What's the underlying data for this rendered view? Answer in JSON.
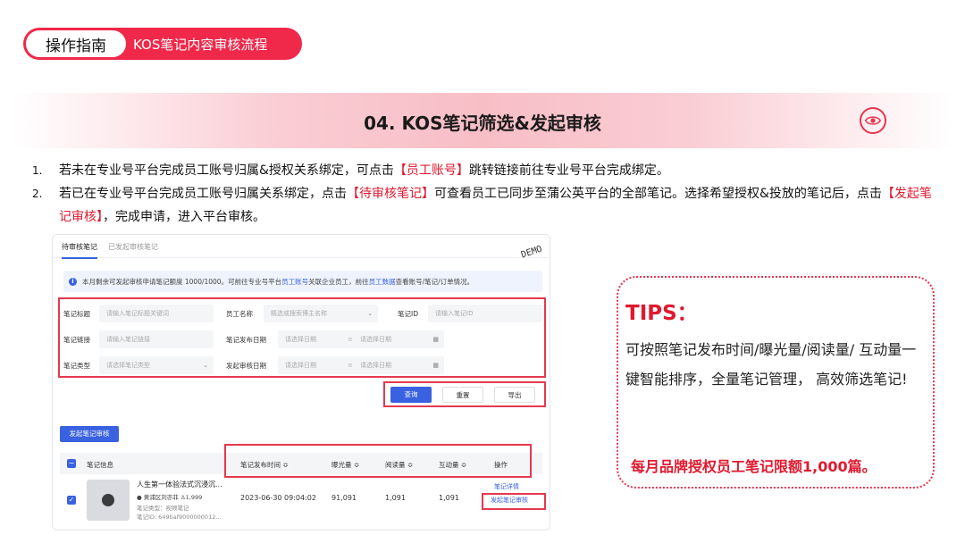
{
  "header": {
    "label": "操作指南",
    "subtitle": "KOS笔记内容审核流程"
  },
  "banner": {
    "title": "04. KOS笔记筛选&发起审核",
    "icon": "eye-icon"
  },
  "steps": [
    {
      "num": "1.",
      "parts": [
        "若未在专业号平台完成员工账号归属&授权关系绑定，可点击",
        "【员工账号】",
        "跳转链接前往专业号平台完成绑定。"
      ]
    },
    {
      "num": "2.",
      "parts": [
        "若已在专业号平台完成员工账号归属关系绑定，点击",
        "【待审核笔记】",
        "可查看员工已同步至蒲公英平台的全部笔记。选择希望授权&投放的笔记后，点击",
        "【发起笔记审核】",
        "，完成申请，进入平台审核。"
      ]
    }
  ],
  "screenshot": {
    "tabs": [
      "待审核笔记",
      "已发起审核笔记"
    ],
    "watermark": "DEMO",
    "notice": {
      "text1": "本月剩余可发起审核申请笔记额度 1000/1000。可前往专业号平台",
      "link1": "员工账号",
      "text2": "关联企业员工，前往",
      "link2": "员工数据",
      "text3": "查看账号/笔记/订单情况。"
    },
    "filters": {
      "note_title_label": "笔记标题",
      "note_title_ph": "请输入笔记标题关键词",
      "staff_label": "员工名称",
      "staff_ph": "精选或搜索博主名称",
      "note_id_label": "笔记ID",
      "note_id_ph": "请输入笔记ID",
      "note_link_label": "笔记链接",
      "note_link_ph": "请输入笔记链接",
      "publish_date_label": "笔记发布日期",
      "date_ph": "请选择日期",
      "note_type_label": "笔记类型",
      "note_type_ph": "请选择笔记类型",
      "review_date_label": "发起审核日期"
    },
    "buttons": {
      "query": "查询",
      "reset": "重置",
      "export": "导出",
      "launch": "发起笔记审核"
    },
    "columns": [
      "笔记信息",
      "笔记发布时间 ≎",
      "曝光量 ≎",
      "阅读量 ≎",
      "互动量 ≎",
      "操作"
    ],
    "row": {
      "title": "人生第一体验法式沉浸沉...",
      "author": "黄浦区刘亦菲",
      "followers": "1,999",
      "type": "笔记类型：视频笔记",
      "note_id": "笔记ID: 649baf9000000012...",
      "publish_time": "2023-06-30 09:04:02",
      "exposure": "91,091",
      "reads": "1,091",
      "interactions": "1,091",
      "action1": "笔记详情",
      "action2": "发起笔记审核"
    }
  },
  "tips": {
    "title": "TIPS：",
    "body": "可按照笔记发布时间/曝光量/阅读量/ 互动量一键智能排序，全量笔记管理， 高效筛选笔记!",
    "footer": "每月品牌授权员工笔记限额1,000篇。"
  },
  "colors": {
    "accent": "#e0192f",
    "pill": "#f0284a",
    "link": "#3a62e0"
  }
}
